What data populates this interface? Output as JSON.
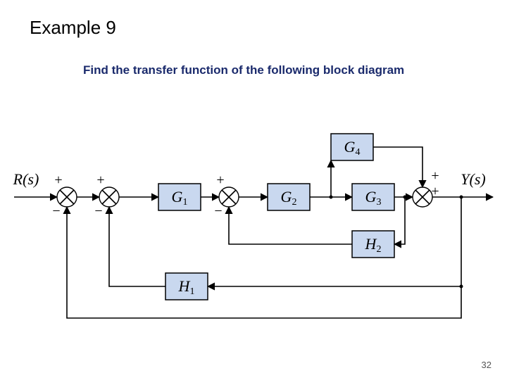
{
  "title": "Example 9",
  "subtitle": "Find the transfer function of the following block diagram",
  "page_number": "32",
  "diagram": {
    "input_label": "R(s)",
    "output_label": "Y(s)",
    "blocks": {
      "G1": {
        "label": "G",
        "sub": "1"
      },
      "G2": {
        "label": "G",
        "sub": "2"
      },
      "G3": {
        "label": "G",
        "sub": "3"
      },
      "G4": {
        "label": "G",
        "sub": "4"
      },
      "H1": {
        "label": "H",
        "sub": "1"
      },
      "H2": {
        "label": "H",
        "sub": "2"
      }
    },
    "summing_junctions": {
      "S1": {
        "top": "+",
        "bottom": "−"
      },
      "S2": {
        "top": "+",
        "bottom": "−"
      },
      "S3": {
        "top": "+",
        "bottom": "−"
      },
      "S4": {
        "top_right": "+",
        "bottom_right": "+"
      }
    }
  }
}
